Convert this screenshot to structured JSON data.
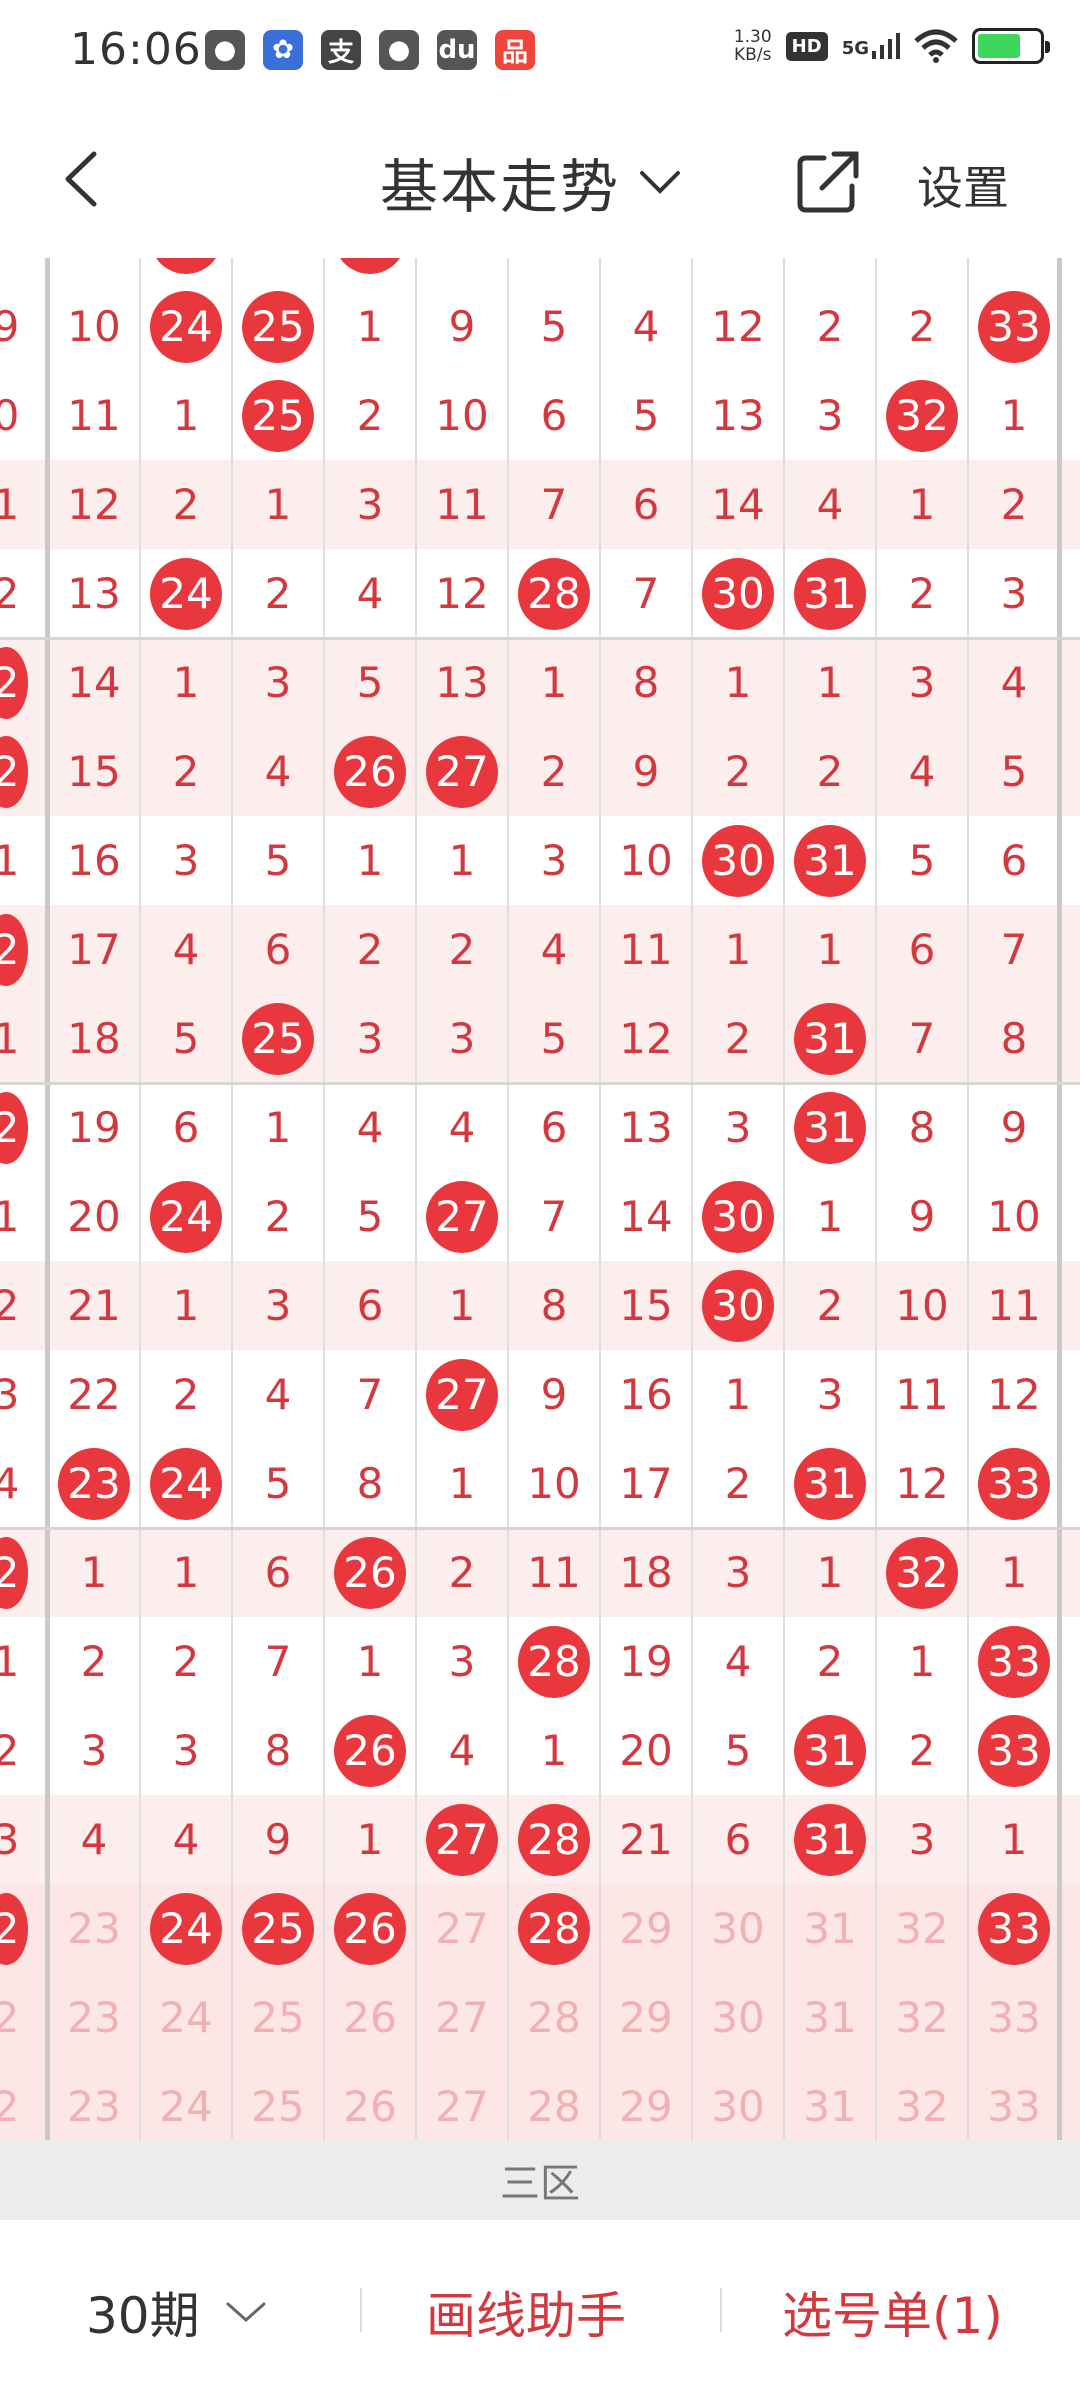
{
  "status": {
    "time": "16:06",
    "net_speed_value": "1.30",
    "net_speed_unit": "KB/s",
    "hd": "HD",
    "signal": "5G",
    "apps": [
      {
        "name": "wechat-icon",
        "glyph": "●",
        "color": "#555555"
      },
      {
        "name": "baidu-icon",
        "glyph": "✿",
        "color": "#3a6fd8"
      },
      {
        "name": "alipay-icon",
        "glyph": "支",
        "color": "#444444"
      },
      {
        "name": "location-icon",
        "glyph": "●",
        "color": "#555555"
      },
      {
        "name": "du-icon",
        "glyph": "du",
        "color": "#555555"
      },
      {
        "name": "app-icon",
        "glyph": "品",
        "color": "#f0453a"
      }
    ]
  },
  "header": {
    "title": "基本走势",
    "settings": "设置"
  },
  "grid": {
    "top_partial_balls": [
      1,
      3
    ],
    "rows": [
      {
        "edge": "9",
        "edge_ball": false,
        "cells": [
          "10",
          "24",
          "25",
          "1",
          "9",
          "5",
          "4",
          "12",
          "2",
          "2",
          "33"
        ],
        "balls": [
          1,
          2,
          10
        ],
        "ghost": false
      },
      {
        "edge": "0",
        "edge_ball": false,
        "cells": [
          "11",
          "1",
          "25",
          "2",
          "10",
          "6",
          "5",
          "13",
          "3",
          "32",
          "1"
        ],
        "balls": [
          2,
          9
        ],
        "ghost": false
      },
      {
        "edge": "1",
        "edge_ball": false,
        "cells": [
          "12",
          "2",
          "1",
          "3",
          "11",
          "7",
          "6",
          "14",
          "4",
          "1",
          "2"
        ],
        "balls": [],
        "ghost": false
      },
      {
        "edge": "2",
        "edge_ball": false,
        "cells": [
          "13",
          "24",
          "2",
          "4",
          "12",
          "28",
          "7",
          "30",
          "31",
          "2",
          "3"
        ],
        "balls": [
          1,
          5,
          7,
          8
        ],
        "ghost": false
      },
      {
        "edge": "2",
        "edge_ball": true,
        "cells": [
          "14",
          "1",
          "3",
          "5",
          "13",
          "1",
          "8",
          "1",
          "1",
          "3",
          "4"
        ],
        "balls": [],
        "ghost": false
      },
      {
        "edge": "2",
        "edge_ball": true,
        "cells": [
          "15",
          "2",
          "4",
          "26",
          "27",
          "2",
          "9",
          "2",
          "2",
          "4",
          "5"
        ],
        "balls": [
          3,
          4
        ],
        "ghost": false
      },
      {
        "edge": "1",
        "edge_ball": false,
        "cells": [
          "16",
          "3",
          "5",
          "1",
          "1",
          "3",
          "10",
          "30",
          "31",
          "5",
          "6"
        ],
        "balls": [
          7,
          8
        ],
        "ghost": false
      },
      {
        "edge": "2",
        "edge_ball": true,
        "cells": [
          "17",
          "4",
          "6",
          "2",
          "2",
          "4",
          "11",
          "1",
          "1",
          "6",
          "7"
        ],
        "balls": [],
        "ghost": false
      },
      {
        "edge": "1",
        "edge_ball": false,
        "cells": [
          "18",
          "5",
          "25",
          "3",
          "3",
          "5",
          "12",
          "2",
          "31",
          "7",
          "8"
        ],
        "balls": [
          2,
          8
        ],
        "ghost": false
      },
      {
        "edge": "2",
        "edge_ball": true,
        "cells": [
          "19",
          "6",
          "1",
          "4",
          "4",
          "6",
          "13",
          "3",
          "31",
          "8",
          "9"
        ],
        "balls": [
          8
        ],
        "ghost": false
      },
      {
        "edge": "1",
        "edge_ball": false,
        "cells": [
          "20",
          "24",
          "2",
          "5",
          "27",
          "7",
          "14",
          "30",
          "1",
          "9",
          "10"
        ],
        "balls": [
          1,
          4,
          7
        ],
        "ghost": false
      },
      {
        "edge": "2",
        "edge_ball": false,
        "cells": [
          "21",
          "1",
          "3",
          "6",
          "1",
          "8",
          "15",
          "30",
          "2",
          "10",
          "11"
        ],
        "balls": [
          7
        ],
        "ghost": false
      },
      {
        "edge": "3",
        "edge_ball": false,
        "cells": [
          "22",
          "2",
          "4",
          "7",
          "27",
          "9",
          "16",
          "1",
          "3",
          "11",
          "12"
        ],
        "balls": [
          4
        ],
        "ghost": false
      },
      {
        "edge": "4",
        "edge_ball": false,
        "cells": [
          "23",
          "24",
          "5",
          "8",
          "1",
          "10",
          "17",
          "2",
          "31",
          "12",
          "33"
        ],
        "balls": [
          0,
          1,
          8,
          10
        ],
        "ghost": false
      },
      {
        "edge": "2",
        "edge_ball": true,
        "cells": [
          "1",
          "1",
          "6",
          "26",
          "2",
          "11",
          "18",
          "3",
          "1",
          "32",
          "1"
        ],
        "balls": [
          3,
          9
        ],
        "ghost": false
      },
      {
        "edge": "1",
        "edge_ball": false,
        "cells": [
          "2",
          "2",
          "7",
          "1",
          "3",
          "28",
          "19",
          "4",
          "2",
          "1",
          "33"
        ],
        "balls": [
          5,
          10
        ],
        "ghost": false
      },
      {
        "edge": "2",
        "edge_ball": false,
        "cells": [
          "3",
          "3",
          "8",
          "26",
          "4",
          "1",
          "20",
          "5",
          "31",
          "2",
          "33"
        ],
        "balls": [
          3,
          8,
          10
        ],
        "ghost": false
      },
      {
        "edge": "3",
        "edge_ball": false,
        "cells": [
          "4",
          "4",
          "9",
          "1",
          "27",
          "28",
          "21",
          "6",
          "31",
          "3",
          "1"
        ],
        "balls": [
          4,
          5,
          8
        ],
        "ghost": false
      },
      {
        "edge": "2",
        "edge_ball": true,
        "cells": [
          "23",
          "24",
          "25",
          "26",
          "27",
          "28",
          "29",
          "30",
          "31",
          "32",
          "33"
        ],
        "balls": [
          1,
          2,
          3,
          5,
          10
        ],
        "ghost": true
      },
      {
        "edge": "2",
        "edge_ball": false,
        "cells": [
          "23",
          "24",
          "25",
          "26",
          "27",
          "28",
          "29",
          "30",
          "31",
          "32",
          "33"
        ],
        "balls": [],
        "ghost": true
      },
      {
        "edge": "2",
        "edge_ball": false,
        "cells": [
          "23",
          "24",
          "25",
          "26",
          "27",
          "28",
          "29",
          "30",
          "31",
          "32",
          "33"
        ],
        "balls": [],
        "ghost": true
      }
    ]
  },
  "zone_label": "三区",
  "bottom": {
    "period": "30期",
    "draw_helper": "画线助手",
    "pick_list": "选号单(1)"
  },
  "colors": {
    "ball": "#e8383d",
    "number": "#d4383f",
    "stripe": "#fdeeee",
    "ghost_band": "#fde7e6"
  }
}
